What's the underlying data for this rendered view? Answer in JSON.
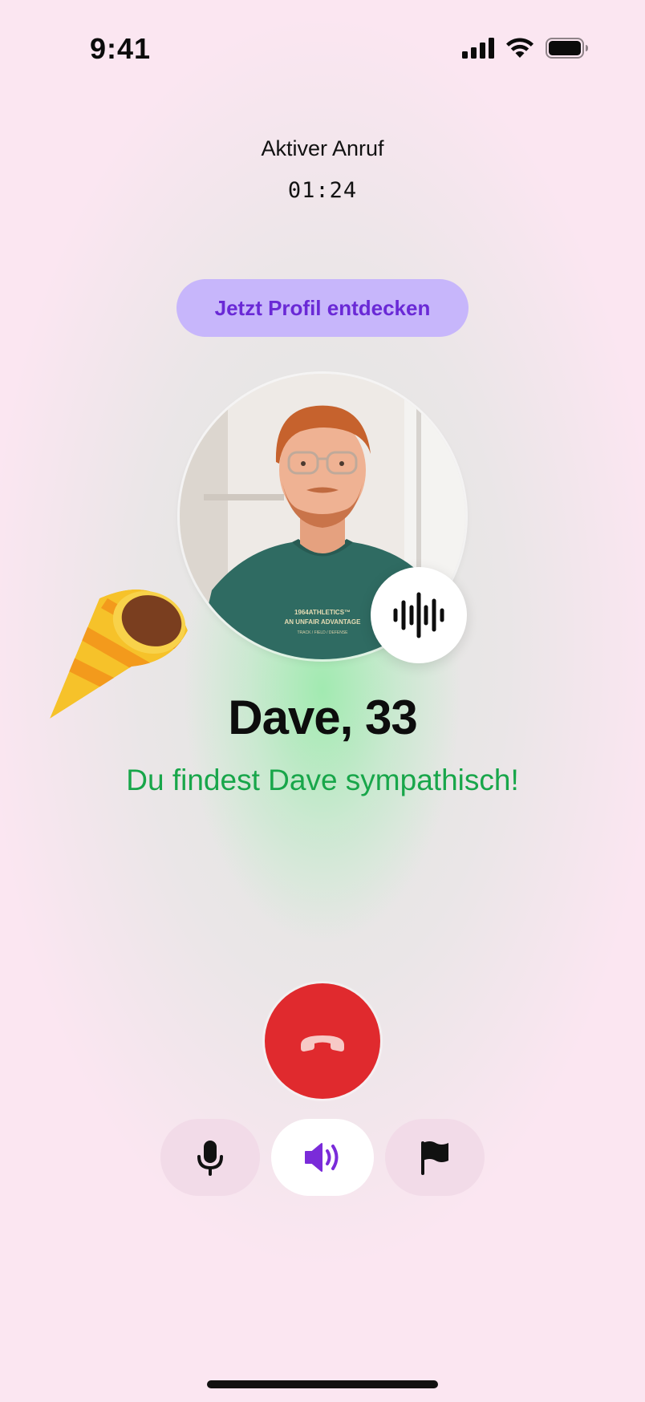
{
  "status_bar": {
    "time": "9:41",
    "icons": [
      "cellular-signal-icon",
      "wifi-icon",
      "battery-icon"
    ]
  },
  "call": {
    "title": "Aktiver Anruf",
    "timer": "01:24"
  },
  "profile_button": {
    "label": "Jetzt Profil entdecken"
  },
  "contact": {
    "name_age": "Dave, 33",
    "status_message": "Du findest Dave sympathisch!",
    "avatar_shirt_line1": "1964ATHLETICS™",
    "avatar_shirt_line2": "AN UNFAIR ADVANTAGE",
    "avatar_shirt_line3": "TRACK / FIELD / DEFENSE"
  },
  "controls": {
    "hangup": "phone-hangup-icon",
    "mute": "microphone-icon",
    "speaker": "speaker-icon",
    "report": "flag-icon"
  },
  "colors": {
    "background": "#fbe6f1",
    "accent_purple": "#6a29d6",
    "pill_bg": "#c7b6fb",
    "success_green": "#18a64a",
    "hangup_red": "#e02a2e"
  }
}
